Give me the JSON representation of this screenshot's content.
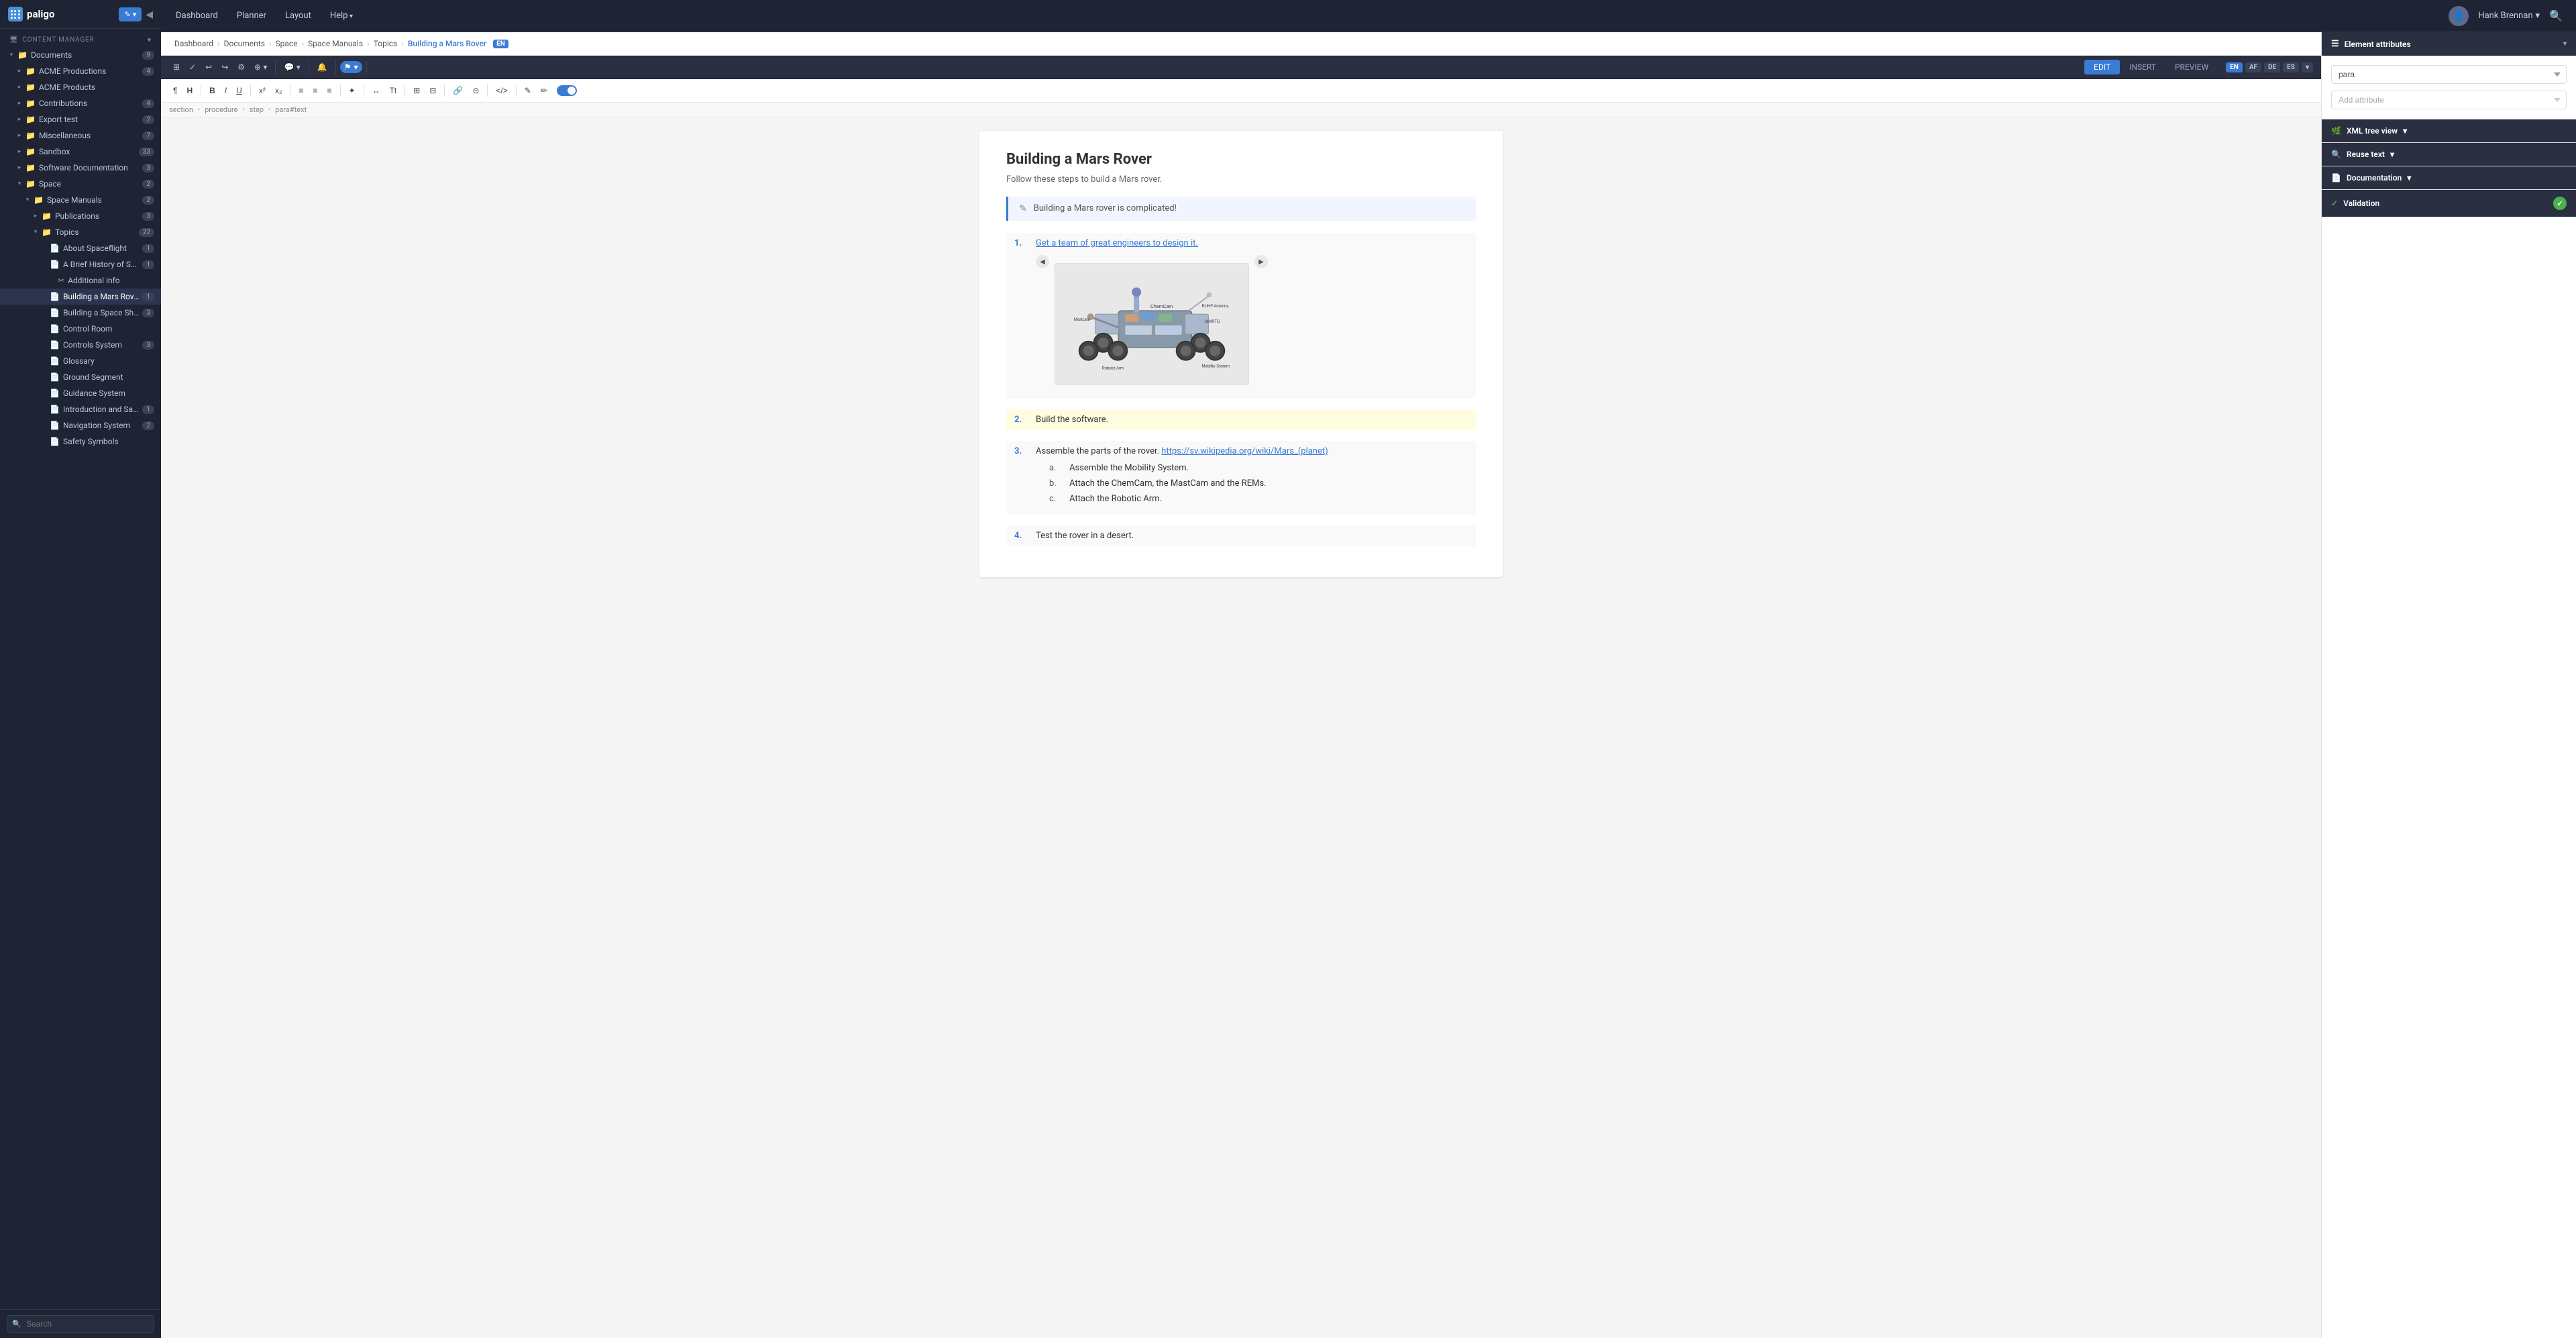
{
  "app": {
    "name": "paligo",
    "logo_text": "paligo"
  },
  "topnav": {
    "items": [
      "Dashboard",
      "Planner",
      "Layout",
      "Help"
    ],
    "user_name": "Hank Brennan",
    "search_label": "Search"
  },
  "sidebar": {
    "section_label": "CONTENT MANAGER",
    "tree": [
      {
        "id": "documents",
        "label": "Documents",
        "type": "folder",
        "badge": "9",
        "level": 0,
        "expanded": true
      },
      {
        "id": "acme-productions",
        "label": "ACME Productions",
        "type": "folder",
        "badge": "4",
        "level": 1,
        "expanded": false
      },
      {
        "id": "acme-products",
        "label": "ACME Products",
        "type": "folder",
        "badge": "",
        "level": 1,
        "expanded": false
      },
      {
        "id": "contributions",
        "label": "Contributions",
        "type": "folder",
        "badge": "4",
        "level": 1,
        "expanded": false
      },
      {
        "id": "export-test",
        "label": "Export test",
        "type": "folder",
        "badge": "2",
        "level": 1,
        "expanded": false
      },
      {
        "id": "miscellaneous",
        "label": "Miscellaneous",
        "type": "folder",
        "badge": "7",
        "level": 1,
        "expanded": false
      },
      {
        "id": "sandbox",
        "label": "Sandbox",
        "type": "folder",
        "badge": "33",
        "level": 1,
        "expanded": false
      },
      {
        "id": "software-documentation",
        "label": "Software Documentation",
        "type": "folder",
        "badge": "3",
        "level": 1,
        "expanded": false
      },
      {
        "id": "space",
        "label": "Space",
        "type": "folder",
        "badge": "2",
        "level": 1,
        "expanded": true
      },
      {
        "id": "space-manuals",
        "label": "Space Manuals",
        "type": "folder",
        "badge": "2",
        "level": 2,
        "expanded": true
      },
      {
        "id": "publications",
        "label": "Publications",
        "type": "folder",
        "badge": "3",
        "level": 3,
        "expanded": false
      },
      {
        "id": "topics",
        "label": "Topics",
        "type": "folder",
        "badge": "22",
        "level": 3,
        "expanded": true
      },
      {
        "id": "about-spaceflight",
        "label": "About Spaceflight",
        "type": "file",
        "badge": "1",
        "level": 4
      },
      {
        "id": "brief-history",
        "label": "A Brief History of Spaceflight",
        "type": "file",
        "badge": "1",
        "level": 4
      },
      {
        "id": "additional-info",
        "label": "Additional info",
        "type": "snippet",
        "badge": "",
        "level": 5
      },
      {
        "id": "building-mars-rover",
        "label": "Building a Mars Rover",
        "type": "file",
        "badge": "1",
        "level": 4,
        "active": true
      },
      {
        "id": "building-space-ship",
        "label": "Building a Space Ship",
        "type": "file",
        "badge": "3",
        "level": 4
      },
      {
        "id": "control-room",
        "label": "Control Room",
        "type": "file",
        "badge": "",
        "level": 4
      },
      {
        "id": "controls-system",
        "label": "Controls System",
        "type": "file",
        "badge": "3",
        "level": 4
      },
      {
        "id": "glossary",
        "label": "Glossary",
        "type": "file",
        "badge": "",
        "level": 4
      },
      {
        "id": "ground-segment",
        "label": "Ground Segment",
        "type": "file",
        "badge": "",
        "level": 4
      },
      {
        "id": "guidance-system",
        "label": "Guidance System",
        "type": "file",
        "badge": "",
        "level": 4
      },
      {
        "id": "introduction-safety",
        "label": "Introduction and Safety",
        "type": "file",
        "badge": "1",
        "level": 4
      },
      {
        "id": "navigation-system",
        "label": "Navigation System",
        "type": "file",
        "badge": "2",
        "level": 4
      },
      {
        "id": "safety-symbols",
        "label": "Safety Symbols",
        "type": "file",
        "badge": "",
        "level": 4
      }
    ],
    "search_placeholder": "Search"
  },
  "breadcrumb": {
    "items": [
      "Dashboard",
      "Documents",
      "Space",
      "Space Manuals",
      "Topics"
    ],
    "current": "Building a Mars Rover",
    "lang": "EN"
  },
  "editor_toolbar": {
    "tabs": [
      "EDIT",
      "INSERT",
      "PREVIEW"
    ],
    "active_tab": "EDIT",
    "lang_badges": [
      "EN",
      "AF",
      "DE",
      "ES"
    ],
    "active_lang": "EN"
  },
  "format_toolbar": {
    "buttons": [
      "¶",
      "H",
      "B",
      "I",
      "U",
      "x²",
      "x₂",
      "≡",
      "≡",
      "≡",
      "✦",
      "↔",
      "Tt",
      "≡",
      "≡",
      "⬡",
      "✎",
      "✎"
    ]
  },
  "element_path": {
    "parts": [
      "section",
      "procedure",
      "step",
      "para#text"
    ]
  },
  "document": {
    "title": "Building a Mars Rover",
    "subtitle": "Follow these steps to build a Mars rover.",
    "note_text": "Building a Mars rover is complicated!",
    "steps": [
      {
        "num": "1.",
        "text": "Get a team of great engineers to design it.",
        "type": "link",
        "has_image": true
      },
      {
        "num": "2.",
        "text": "Build the software.",
        "type": "highlight"
      },
      {
        "num": "3.",
        "text": "Assemble the parts of the rover. ",
        "link": "https://sv.wikipedia.org/wiki/Mars_(planet)",
        "type": "link_inline",
        "sub_steps": [
          {
            "letter": "a.",
            "text": "Assemble the Mobility System."
          },
          {
            "letter": "b.",
            "text": "Attach the ChemCam, the MastCam and the REMs."
          },
          {
            "letter": "c.",
            "text": "Attach the Robotic Arm."
          }
        ]
      },
      {
        "num": "4.",
        "text": "Test the rover in a desert.",
        "type": "plain"
      }
    ]
  },
  "right_panel": {
    "sections": [
      {
        "id": "element-attributes",
        "label": "Element attributes",
        "icon": "☰",
        "attr_value": "para",
        "add_attr_label": "Add attribute"
      },
      {
        "id": "xml-tree-view",
        "label": "XML tree view",
        "icon": "🌳"
      },
      {
        "id": "reuse-text",
        "label": "Reuse text",
        "icon": "🔍"
      },
      {
        "id": "documentation",
        "label": "Documentation",
        "icon": "📄"
      },
      {
        "id": "validation",
        "label": "Validation",
        "icon": "✓",
        "has_check": true
      }
    ]
  }
}
